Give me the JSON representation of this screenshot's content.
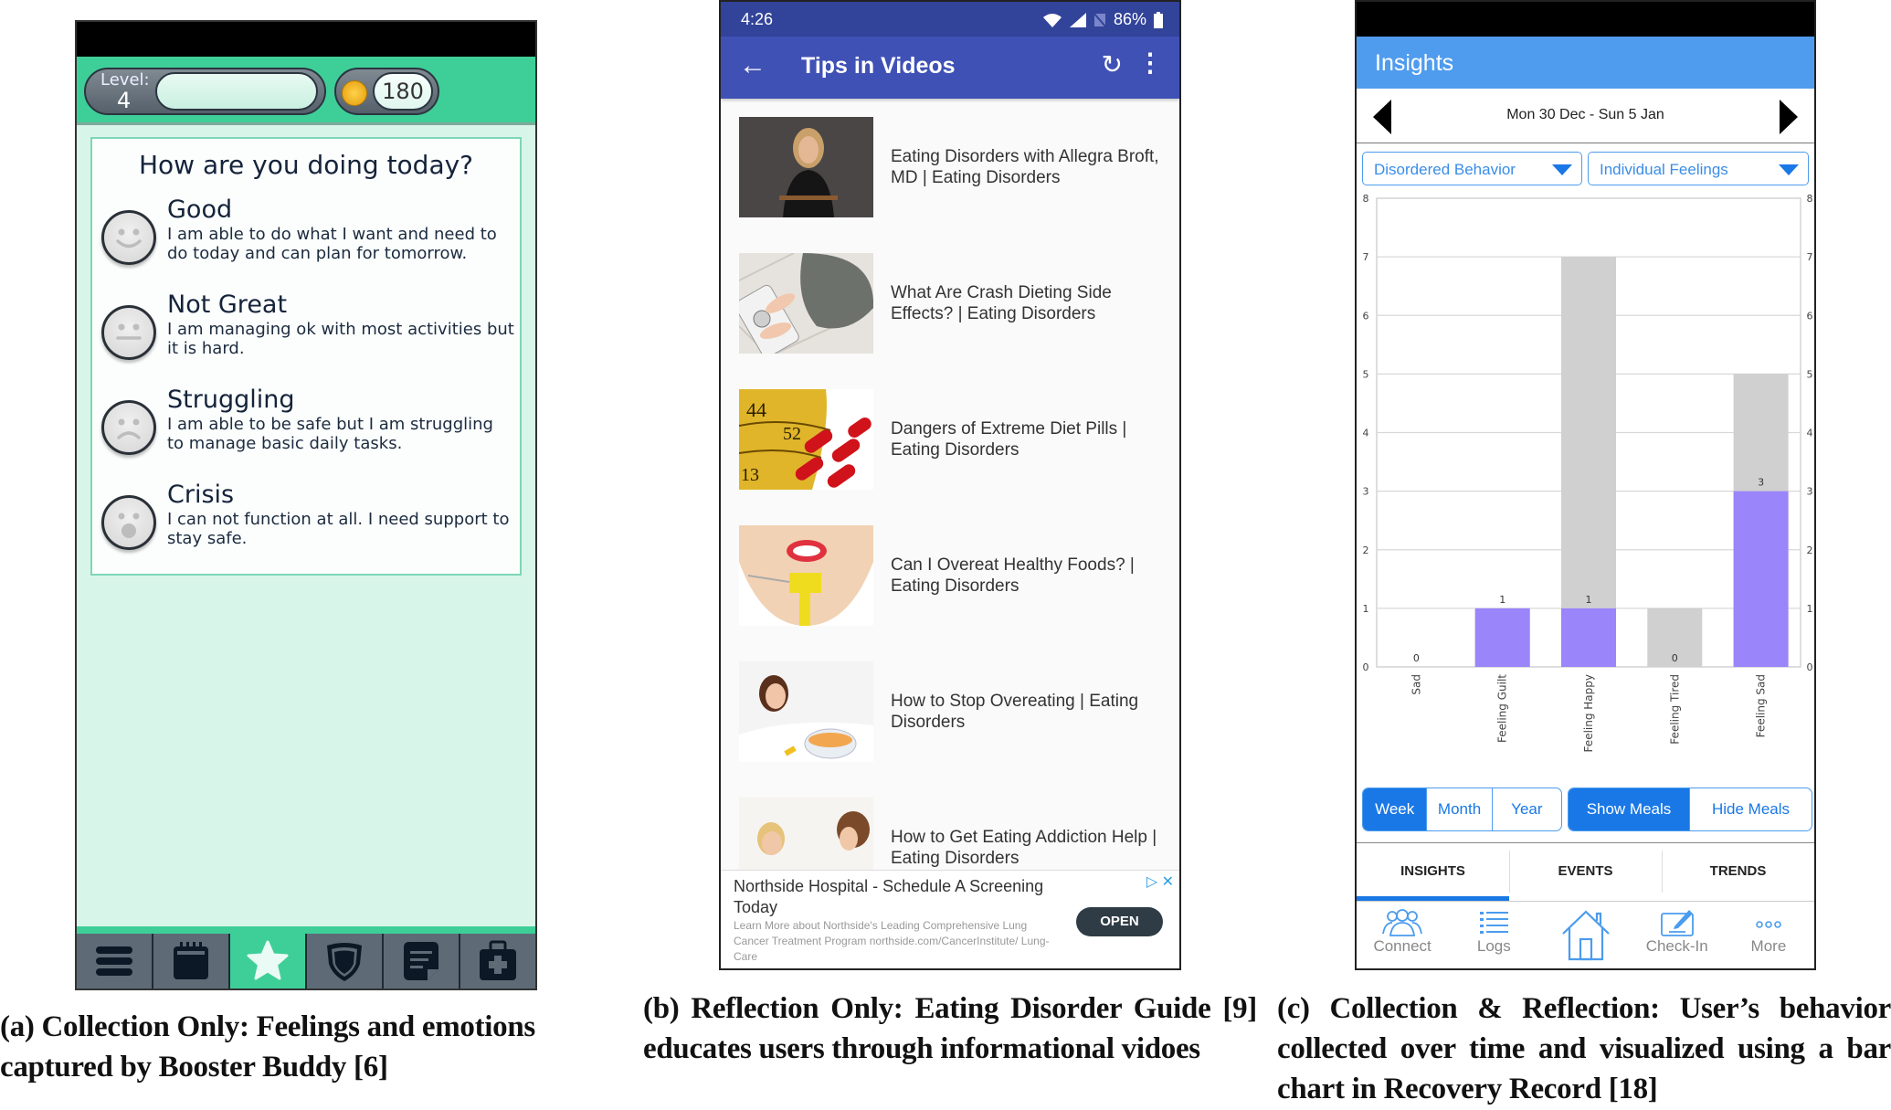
{
  "panel_a": {
    "level_label": "Level:",
    "level_value": "4",
    "xp_progress": 0,
    "coins": "180",
    "question": "How are you doing today?",
    "moods": [
      {
        "name": "Good",
        "desc": "I am able to do what I want and need to do today and can plan for tomorrow.",
        "icon": "smile-face-icon"
      },
      {
        "name": "Not Great",
        "desc": "I am managing ok with most activities but it is hard.",
        "icon": "neutral-face-icon"
      },
      {
        "name": "Struggling",
        "desc": "I am able to be safe but I am struggling to manage basic daily tasks.",
        "icon": "frown-face-icon"
      },
      {
        "name": "Crisis",
        "desc": "I can not function at all. I need support to stay safe.",
        "icon": "shocked-face-icon"
      }
    ],
    "bottom_tabs": [
      "menu-icon",
      "calendar-icon",
      "star-icon",
      "shield-icon",
      "notes-icon",
      "first-aid-kit-icon"
    ],
    "active_tab": 2,
    "colors": {
      "header": "#3ecf98",
      "background": "#d8f5ea",
      "tabbar": "#5e6b76"
    }
  },
  "panel_b": {
    "status_time": "4:26",
    "battery": "86%",
    "title": "Tips in Videos",
    "videos": [
      {
        "title": "Eating Disorders with Allegra Broft, MD | Eating Disorders"
      },
      {
        "title": "What Are Crash Dieting Side Effects? | Eating Disorders"
      },
      {
        "title": "Dangers of Extreme Diet Pills | Eating Disorders"
      },
      {
        "title": "Can I Overeat Healthy Foods? | Eating Disorders"
      },
      {
        "title": "How to Stop Overeating | Eating Disorders"
      },
      {
        "title": "How to Get Eating Addiction Help | Eating Disorders"
      }
    ],
    "ad": {
      "title": "Northside Hospital - Schedule A Screening Today",
      "desc": "Learn More about Northside's Leading Comprehensive Lung Cancer Treatment Program northside.com/CancerInstitute/ Lung-Care",
      "button": "OPEN"
    },
    "colors": {
      "appbar": "#3f51b5",
      "statusbar": "#32439a"
    }
  },
  "panel_c": {
    "title": "Insights",
    "date_range": "Mon 30 Dec - Sun 5 Jan",
    "dropdown_1": "Disordered Behavior",
    "dropdown_2": "Individual Feelings",
    "period_options": [
      "Week",
      "Month",
      "Year"
    ],
    "period_selected": "Week",
    "meal_options": [
      "Show Meals",
      "Hide Meals"
    ],
    "meal_selected": "Show Meals",
    "tabs": [
      "INSIGHTS",
      "EVENTS",
      "TRENDS"
    ],
    "active_tab": "INSIGHTS",
    "nav": [
      {
        "label": "Connect",
        "icon": "people-icon"
      },
      {
        "label": "Logs",
        "icon": "list-icon"
      },
      {
        "label": "",
        "icon": "home-icon"
      },
      {
        "label": "Check-In",
        "icon": "edit-icon"
      },
      {
        "label": "More",
        "icon": "more-dots-icon"
      }
    ],
    "colors": {
      "accent": "#1a78e6",
      "header": "#4f9cee",
      "purple": "#9a85fb",
      "gray": "#d0d0d0"
    }
  },
  "chart_data": {
    "type": "bar",
    "title": "",
    "xlabel": "",
    "ylabel": "",
    "categories": [
      "Sad",
      "Feeling Guilt",
      "Feeling Happy",
      "Feeling Tired",
      "Feeling Sad"
    ],
    "series": [
      {
        "name": "highlighted",
        "color": "#9a85fb",
        "values": [
          0,
          1,
          1,
          0,
          3
        ]
      },
      {
        "name": "total",
        "color": "#d0d0d0",
        "values": [
          0,
          1,
          7,
          1,
          5
        ]
      }
    ],
    "data_labels": [
      "0",
      "1",
      "1",
      "0",
      "3"
    ],
    "ylim": [
      0,
      8
    ],
    "yticks": [
      0,
      1,
      2,
      3,
      4,
      5,
      6,
      7,
      8
    ],
    "grid": true,
    "dual_y_axis": true
  },
  "captions": {
    "a": "(a) Collection Only: Feelings and emotions captured by Booster Buddy [6]",
    "b": "(b) Reflection Only: Eating Disorder Guide [9] educates users through informational vidoes",
    "c": "(c) Collection & Reflection: User’s behavior collected over time and visualized using a bar chart in Recovery Record [18]"
  }
}
